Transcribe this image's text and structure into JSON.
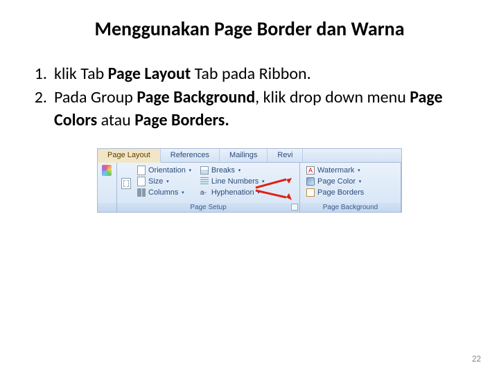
{
  "title": "Menggunakan Page Border dan Warna",
  "steps": [
    {
      "num": "1.",
      "pre": "klik Tab ",
      "b1": "Page Layout",
      "mid": " Tab pada Ribbon."
    },
    {
      "num": "2.",
      "pre": "Pada Group ",
      "b1": "Page Background",
      "mid": ", klik drop down menu ",
      "b2": "Page Colors",
      "mid2": " atau ",
      "b3": "Page Borders."
    }
  ],
  "page_number": "22",
  "ribbon": {
    "tabs": [
      "Page Layout",
      "References",
      "Mailings",
      "Revi"
    ],
    "active_tab": 0,
    "g_setup": {
      "orientation": "Orientation",
      "size": "Size",
      "columns": "Columns",
      "breaks": "Breaks",
      "line_numbers": "Line Numbers",
      "hyphenation": "Hyphenation",
      "label": "Page Setup"
    },
    "g_bg": {
      "watermark": "Watermark",
      "page_color": "Page Color",
      "page_borders": "Page Borders",
      "label": "Page Background"
    }
  }
}
